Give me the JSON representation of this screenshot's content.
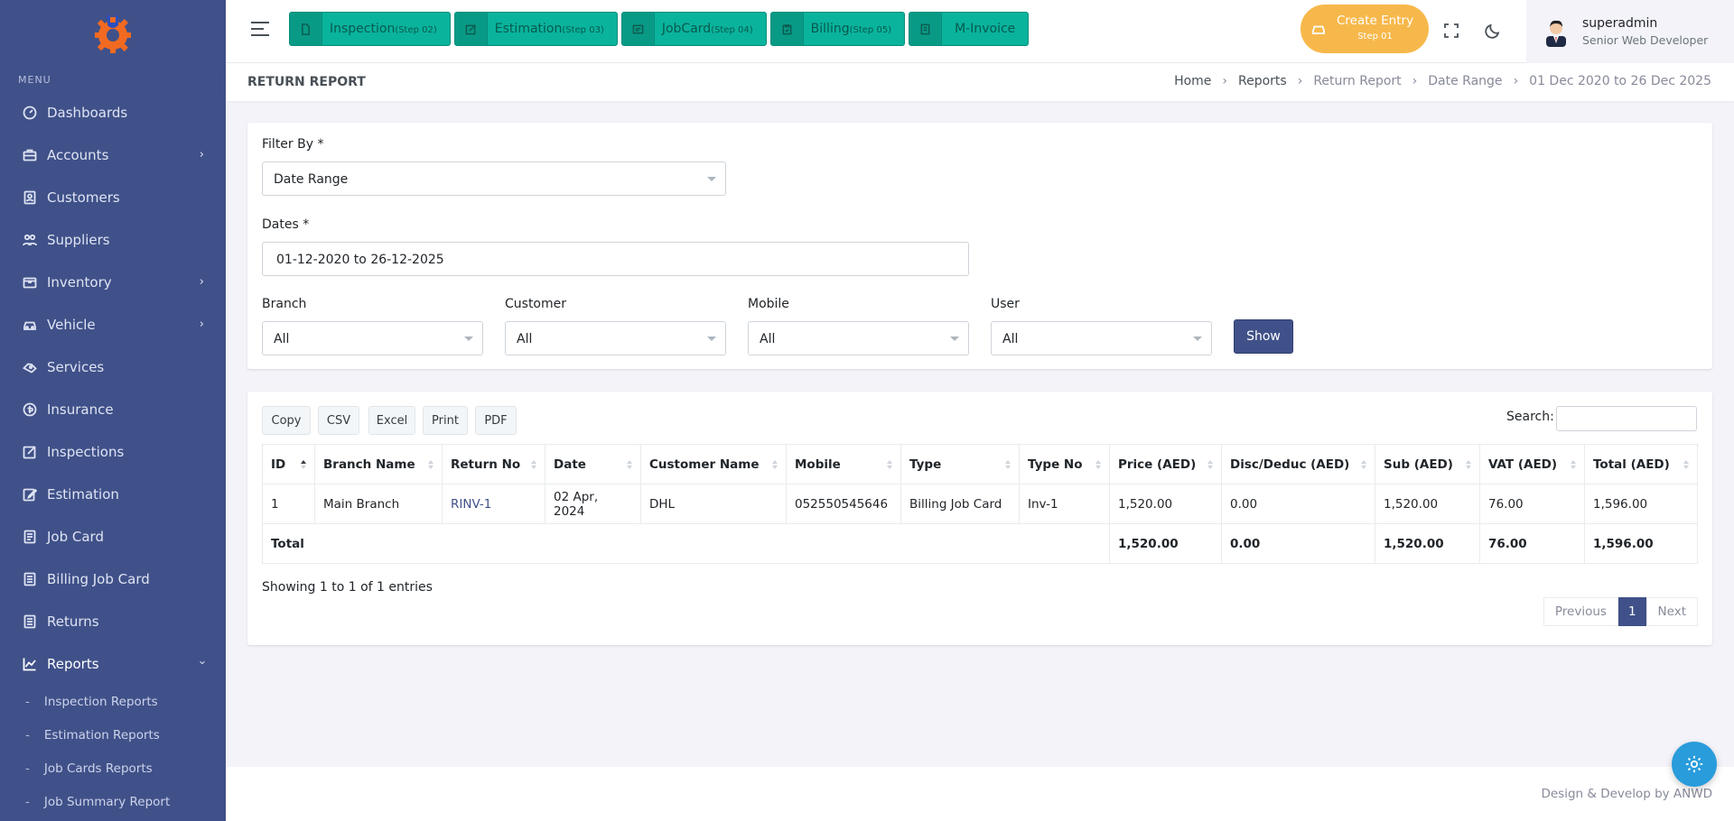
{
  "sidebar": {
    "menu_title": "MENU",
    "items": [
      {
        "label": "Dashboards",
        "icon": "dashboard-icon"
      },
      {
        "label": "Accounts",
        "icon": "briefcase-icon"
      },
      {
        "label": "Customers",
        "icon": "customers-icon"
      },
      {
        "label": "Suppliers",
        "icon": "suppliers-icon"
      },
      {
        "label": "Inventory",
        "icon": "inventory-icon"
      },
      {
        "label": "Vehicle",
        "icon": "car-icon"
      },
      {
        "label": "Services",
        "icon": "services-icon"
      },
      {
        "label": "Insurance",
        "icon": "insurance-icon"
      },
      {
        "label": "Inspections",
        "icon": "inspections-icon"
      },
      {
        "label": "Estimation",
        "icon": "estimation-icon"
      },
      {
        "label": "Job Card",
        "icon": "jobcard-icon"
      },
      {
        "label": "Billing Job Card",
        "icon": "billing-icon"
      },
      {
        "label": "Returns",
        "icon": "returns-icon"
      },
      {
        "label": "Reports",
        "icon": "reports-chart-icon"
      }
    ],
    "sub_items": [
      "Inspection Reports",
      "Estimation Reports",
      "Job Cards Reports",
      "Job Summary Report"
    ]
  },
  "topbar": {
    "steps": [
      {
        "label": "Inspection",
        "step": "(Step 02)"
      },
      {
        "label": "Estimation",
        "step": "(Step 03)"
      },
      {
        "label": "JobCard",
        "step": "(Step 04)"
      },
      {
        "label": "Billing",
        "step": "(Step 05)"
      },
      {
        "label": "M-Invoice",
        "step": ""
      }
    ],
    "create_label": "Create Entry",
    "create_step": "Step 01",
    "user_name": "superadmin",
    "user_role": "Senior Web Developer"
  },
  "page": {
    "title": "RETURN REPORT",
    "breadcrumbs": [
      "Home",
      "Reports",
      "Return Report",
      "Date Range",
      "01 Dec 2020 to 26 Dec 2025"
    ]
  },
  "filters": {
    "filter_by_label": "Filter By *",
    "filter_by_value": "Date Range",
    "dates_label": "Dates *",
    "dates_value": "01-12-2020 to 26-12-2025",
    "branch_label": "Branch",
    "branch_value": "All",
    "customer_label": "Customer",
    "customer_value": "All",
    "mobile_label": "Mobile",
    "mobile_value": "All",
    "user_label": "User",
    "user_value": "All",
    "show_label": "Show"
  },
  "table": {
    "export_buttons": [
      "Copy",
      "CSV",
      "Excel",
      "Print",
      "PDF"
    ],
    "search_label": "Search:",
    "columns": [
      "ID",
      "Branch Name",
      "Return No",
      "Date",
      "Customer Name",
      "Mobile",
      "Type",
      "Type No",
      "Price (AED)",
      "Disc/Deduc (AED)",
      "Sub (AED)",
      "VAT (AED)",
      "Total (AED)"
    ],
    "rows": [
      [
        "1",
        "Main Branch",
        "RINV-1",
        "02 Apr, 2024",
        "DHL",
        "052550545646",
        "Billing Job Card",
        "Inv-1",
        "1,520.00",
        "0.00",
        "1,520.00",
        "76.00",
        "1,596.00"
      ]
    ],
    "total": {
      "label": "Total",
      "price": "1,520.00",
      "disc": "0.00",
      "sub": "1,520.00",
      "vat": "76.00",
      "total": "1,596.00"
    },
    "info": "Showing 1 to 1 of 1 entries",
    "pager": {
      "previous": "Previous",
      "current": "1",
      "next": "Next"
    }
  },
  "footer": {
    "text": "Design & Develop by ANWD"
  },
  "colors": {
    "sidebar": "#405189",
    "step": "#0ab39c",
    "create": "#f7b84b",
    "primary": "#405189",
    "gear": "#299cdb"
  }
}
